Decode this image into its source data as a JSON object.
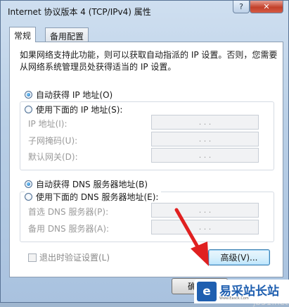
{
  "window": {
    "title": "Internet 协议版本 4 (TCP/IPv4) 属性",
    "help_label": "?",
    "close_label": "✕"
  },
  "tabs": [
    {
      "label": "常规",
      "active": true
    },
    {
      "label": "备用配置",
      "active": false
    }
  ],
  "description": "如果网络支持此功能，则可以获取自动指派的 IP 设置。否则，您需要从网络系统管理员处获得适当的 IP 设置。",
  "ip_section": {
    "auto_label": "自动获得 IP 地址(O)",
    "manual_label": "使用下面的 IP 地址(S):",
    "selected": "auto",
    "fields": [
      {
        "label": "IP 地址(I):",
        "value": ". . ."
      },
      {
        "label": "子网掩码(U):",
        "value": ". . ."
      },
      {
        "label": "默认网关(D):",
        "value": ". . ."
      }
    ]
  },
  "dns_section": {
    "auto_label": "自动获得 DNS 服务器地址(B)",
    "manual_label": "使用下面的 DNS 服务器地址(E):",
    "selected": "auto",
    "fields": [
      {
        "label": "首选 DNS 服务器(P):",
        "value": ". . ."
      },
      {
        "label": "备用 DNS 服务器(A):",
        "value": ". . ."
      }
    ]
  },
  "validate_on_exit": {
    "label": "退出时验证设置(L)",
    "checked": false
  },
  "buttons": {
    "advanced": "高级(V)...",
    "ok": "确"
  },
  "faint_text": "jb51.net",
  "watermark": {
    "logo": "e",
    "text": "易采站长站",
    "subtext": "Www.Easck.Com"
  },
  "colors": {
    "titlebar": "#b9cfe6",
    "close_button": "#c2402a",
    "arrow": "#e02020",
    "watermark_blue": "#1f5fb0"
  }
}
